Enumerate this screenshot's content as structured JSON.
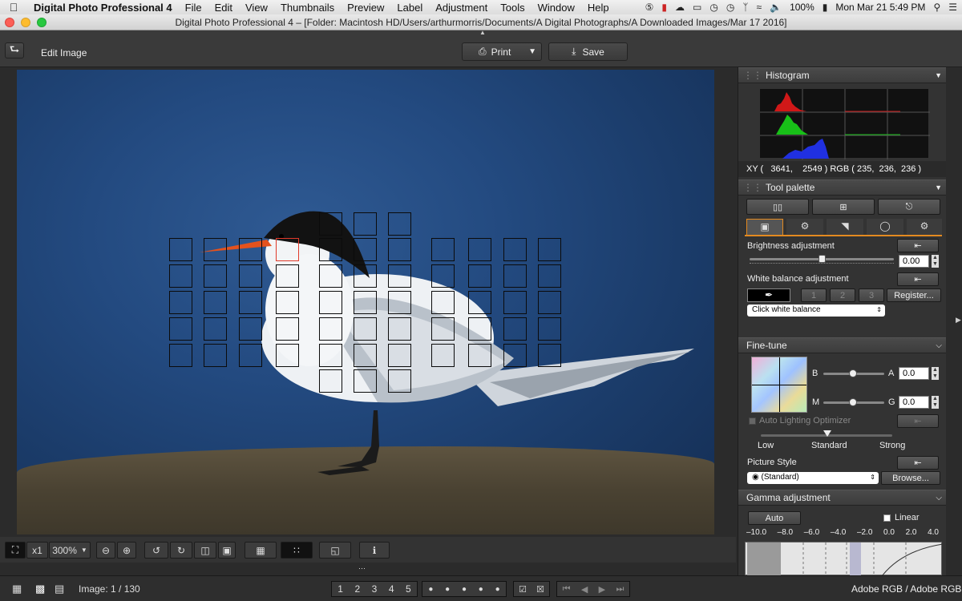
{
  "menubar": {
    "app": "Digital Photo Professional 4",
    "items": [
      "File",
      "Edit",
      "View",
      "Thumbnails",
      "Preview",
      "Label",
      "Adjustment",
      "Tools",
      "Window",
      "Help"
    ],
    "battery": "100%",
    "datetime": "Mon Mar 21  5:49 PM"
  },
  "window": {
    "title": "Digital Photo Professional 4 – [Folder: Macintosh HD/Users/arthurmorris/Documents/A Digital Photographs/A Downloaded Images/Mar 17 2016]"
  },
  "toolbar": {
    "back_icon": "return-arrow-icon",
    "mode": "Edit Image",
    "print_label": "Print",
    "save_label": "Save"
  },
  "bottombar": {
    "zoom_x1": "x1",
    "zoom_value": "300%",
    "nav_numbers": [
      "1",
      "2",
      "3",
      "4",
      "5"
    ],
    "image_counter": "Image: 1 / 130",
    "color_space": "Adobe RGB / Adobe RGB"
  },
  "histogram": {
    "title": "Histogram",
    "readout": "XY (   3641,    2549 ) RGB ( 235,  236,  236 )",
    "colors": {
      "red": "#d01818",
      "green": "#18c018",
      "blue": "#2030e0"
    }
  },
  "tool_palette": {
    "title": "Tool palette",
    "brightness": {
      "label": "Brightness adjustment",
      "value": "0.00",
      "level": 0.5
    },
    "white_balance": {
      "label": "White balance adjustment",
      "presets": [
        "1",
        "2",
        "3"
      ],
      "register": "Register...",
      "select": "Click white balance"
    },
    "fine_tune": {
      "title": "Fine-tune",
      "b_label": "B",
      "a_label": "A",
      "a_value": "0.0",
      "m_label": "M",
      "g_label": "G",
      "g_value": "0.0"
    },
    "alo": {
      "label": "Auto Lighting Optimizer",
      "levels": [
        "Low",
        "Standard",
        "Strong"
      ]
    },
    "picture_style": {
      "label": "Picture Style",
      "value": "(Standard)",
      "browse": "Browse..."
    },
    "gamma": {
      "title": "Gamma adjustment",
      "auto": "Auto",
      "linear": "Linear",
      "scale": [
        "–10.0",
        "–8.0",
        "–6.0",
        "–4.0",
        "–2.0",
        "0.0",
        "2.0",
        "4.0"
      ]
    }
  }
}
